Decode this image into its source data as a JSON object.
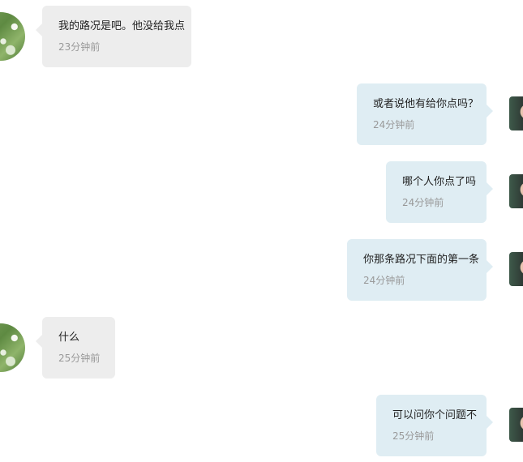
{
  "messages": [
    {
      "direction": "in",
      "text": "我的路况是吧。他没给我点",
      "time": "23分钟前",
      "avatar": "flower-avatar"
    },
    {
      "direction": "out",
      "text": "或者说他有给你点吗？",
      "time": "24分钟前",
      "avatar": "user-photo-avatar"
    },
    {
      "direction": "out",
      "text": "哪个人你点了吗",
      "time": "24分钟前",
      "avatar": "user-photo-avatar"
    },
    {
      "direction": "out",
      "text": "你那条路况下面的第一条",
      "time": "24分钟前",
      "avatar": "user-photo-avatar"
    },
    {
      "direction": "in",
      "text": "什么",
      "time": "25分钟前",
      "avatar": "flower-avatar"
    },
    {
      "direction": "out",
      "text": "可以问你个问题不",
      "time": "25分钟前",
      "avatar": "user-photo-avatar"
    }
  ],
  "colors": {
    "incoming_bubble": "#ededed",
    "outgoing_bubble": "#dfedf3",
    "timestamp": "#999999"
  }
}
